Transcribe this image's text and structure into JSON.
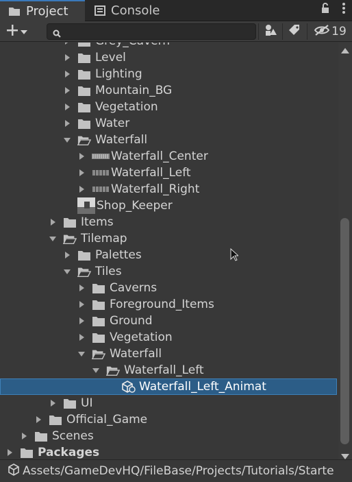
{
  "tabs": {
    "project": "Project",
    "console": "Console"
  },
  "toolbar": {
    "search_placeholder": "",
    "search_value": "",
    "hidden_count": "19"
  },
  "tree": [
    {
      "label": "Grey_Cavern",
      "depth": 4,
      "arrow": "right",
      "icon": "folder",
      "partial": true
    },
    {
      "label": "Level",
      "depth": 4,
      "arrow": "right",
      "icon": "folder"
    },
    {
      "label": "Lighting",
      "depth": 4,
      "arrow": "right",
      "icon": "folder"
    },
    {
      "label": "Mountain_BG",
      "depth": 4,
      "arrow": "right",
      "icon": "folder"
    },
    {
      "label": "Vegetation",
      "depth": 4,
      "arrow": "right",
      "icon": "folder"
    },
    {
      "label": "Water",
      "depth": 4,
      "arrow": "right",
      "icon": "folder"
    },
    {
      "label": "Waterfall",
      "depth": 4,
      "arrow": "down",
      "icon": "folder-open"
    },
    {
      "label": "Waterfall_Center",
      "depth": 5,
      "arrow": "right",
      "icon": "sprite-wide"
    },
    {
      "label": "Waterfall_Left",
      "depth": 5,
      "arrow": "right",
      "icon": "sprite-strip"
    },
    {
      "label": "Waterfall_Right",
      "depth": 5,
      "arrow": "right",
      "icon": "sprite-strip"
    },
    {
      "label": "Shop_Keeper",
      "depth": 4,
      "arrow": "none",
      "icon": "image"
    },
    {
      "label": "Items",
      "depth": 3,
      "arrow": "right",
      "icon": "folder"
    },
    {
      "label": "Tilemap",
      "depth": 3,
      "arrow": "down",
      "icon": "folder-open"
    },
    {
      "label": "Palettes",
      "depth": 4,
      "arrow": "right",
      "icon": "folder"
    },
    {
      "label": "Tiles",
      "depth": 4,
      "arrow": "down",
      "icon": "folder-open"
    },
    {
      "label": "Caverns",
      "depth": 5,
      "arrow": "right",
      "icon": "folder"
    },
    {
      "label": "Foreground_Items",
      "depth": 5,
      "arrow": "right",
      "icon": "folder"
    },
    {
      "label": "Ground",
      "depth": 5,
      "arrow": "right",
      "icon": "folder"
    },
    {
      "label": "Vegetation",
      "depth": 5,
      "arrow": "right",
      "icon": "folder"
    },
    {
      "label": "Waterfall",
      "depth": 5,
      "arrow": "down",
      "icon": "folder-open"
    },
    {
      "label": "Waterfall_Left",
      "depth": 6,
      "arrow": "down",
      "icon": "folder-open"
    },
    {
      "label": "Waterfall_Left_Animat",
      "depth": 7,
      "arrow": "none",
      "icon": "animated-tile",
      "selected": true
    },
    {
      "label": "UI",
      "depth": 3,
      "arrow": "right",
      "icon": "folder"
    },
    {
      "label": "Official_Game",
      "depth": 2,
      "arrow": "right",
      "icon": "folder"
    },
    {
      "label": "Scenes",
      "depth": 1,
      "arrow": "right",
      "icon": "folder"
    },
    {
      "label": "Packages",
      "depth": 0,
      "arrow": "right",
      "icon": "folder",
      "bold": true
    }
  ],
  "status": {
    "path": "Assets/GameDevHQ/FileBase/Projects/Tutorials/Starte"
  },
  "colors": {
    "panel": "#383838",
    "tabbar": "#282828",
    "selection": "#2c5d87",
    "accent": "#3a79bb",
    "text": "#d4d4d4"
  }
}
